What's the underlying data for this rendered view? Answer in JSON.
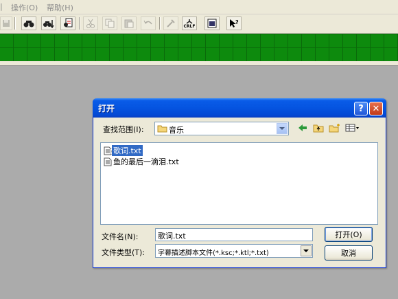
{
  "menu": {
    "items": [
      "操作(O)",
      "帮助(H)"
    ]
  },
  "toolbar": {
    "buttons": [
      "save-icon",
      "find-icon",
      "find-next-icon",
      "replace-icon",
      "cut-icon",
      "copy-icon",
      "paste-icon",
      "undo-icon",
      "tool-icon",
      "crlf-icon",
      "window-icon",
      "help-pointer-icon"
    ],
    "crlf_label": "CRLF"
  },
  "colors": {
    "band": "#0d8a0d",
    "titlebar": "#0554e0",
    "selection": "#316ac5"
  },
  "dialog": {
    "title": "打开",
    "help_label": "?",
    "close_label": "✕",
    "look_in_label": "查找范围(I):",
    "look_in_value": "音乐",
    "files": [
      {
        "name": "歌词.txt",
        "selected": true
      },
      {
        "name": "鱼的最后一滴泪.txt",
        "selected": false
      }
    ],
    "filename_label": "文件名(N):",
    "filename_value": "歌词.txt",
    "filetype_label": "文件类型(T):",
    "filetype_value": "字幕描述脚本文件(*.ksc;*.ktl;*.txt)",
    "open_button": "打开(O)",
    "cancel_button": "取消"
  }
}
